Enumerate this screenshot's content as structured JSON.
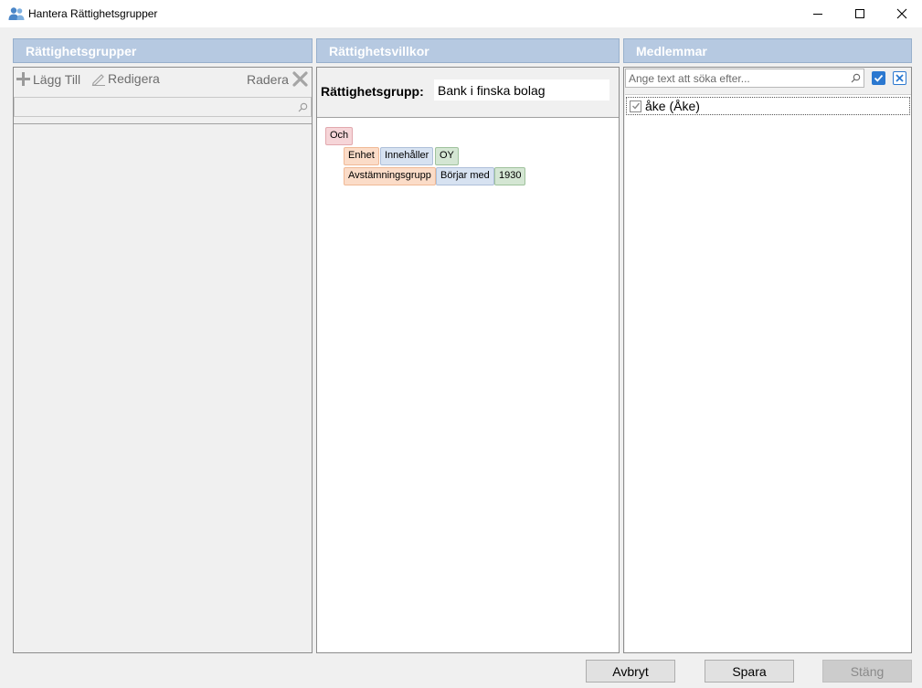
{
  "window": {
    "title": "Hantera Rättighetsgrupper",
    "icon": "users-icon"
  },
  "left_panel": {
    "header": "Rättighetsgrupper",
    "toolbar": {
      "add_label": "Lägg Till",
      "edit_label": "Redigera",
      "delete_label": "Radera"
    },
    "search": {
      "value": "",
      "placeholder": ""
    },
    "items": []
  },
  "middle_panel": {
    "header": "Rättighetsvillkor",
    "group_label": "Rättighetsgrupp:",
    "group_value": "Bank i finska bolag",
    "conditions": {
      "operator": "Och",
      "rules": [
        {
          "field": "Enhet",
          "comparator": "Innehåller",
          "value": "OY"
        },
        {
          "field": "Avstämningsgrupp",
          "comparator": "Börjar med",
          "value": "1930"
        }
      ]
    }
  },
  "right_panel": {
    "header": "Medlemmar",
    "search": {
      "value": "",
      "placeholder": "Ange text att söka efter..."
    },
    "members": [
      {
        "name": "åke (Åke)",
        "checked": true
      }
    ]
  },
  "footer": {
    "cancel_label": "Avbryt",
    "save_label": "Spara",
    "close_label": "Stäng",
    "close_enabled": false
  },
  "colors": {
    "header_bg": "#b6c9e1",
    "accent_blue": "#2b78d0",
    "operator_chip": "#f6d5d8",
    "field_chip": "#fbdcc8",
    "comparator_chip": "#d7e2f1",
    "value_chip": "#d4e6d3"
  }
}
